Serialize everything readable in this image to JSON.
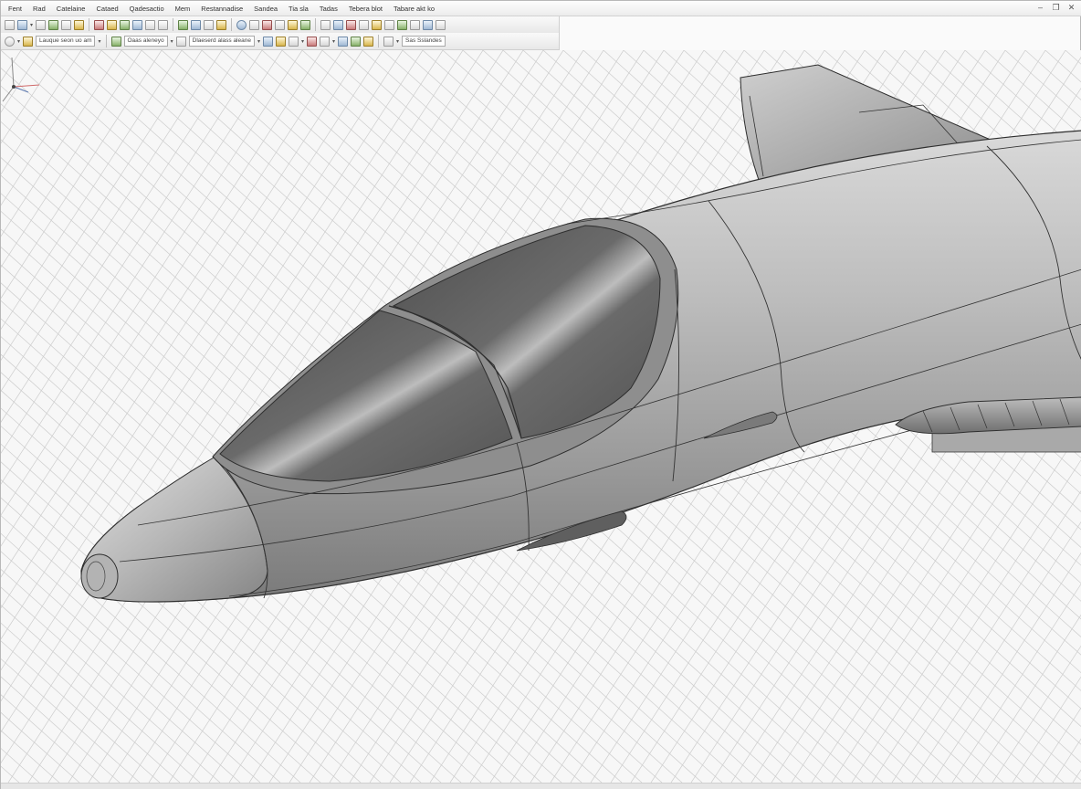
{
  "menu": {
    "items": [
      "Fent",
      "Rad",
      "Catelaine",
      "Cataed",
      "Qadesactio",
      "Mem",
      "Restannadise",
      "Sandea",
      "Tia sla",
      "Tadas",
      "Tebera blot",
      "Tabare akt ko"
    ]
  },
  "toolbar": {
    "layer_combo": "Lauque seon uo am",
    "view_combo": "Oaas aleneyo",
    "filter_combo": "Dlaeserd alass aleane",
    "snap_combo": "Sas Sslandes"
  },
  "viewport": {
    "model": "jet-fuselage-nose",
    "grid": true,
    "colors": {
      "background": "#f7f7f7",
      "grid_line": "#cdcdcd",
      "body_light": "#dcdcdc",
      "body_mid": "#a4a4a4",
      "body_dark": "#6f6f6f",
      "canopy": "#5d5d5d",
      "edge": "#2e2e2e"
    }
  },
  "icons": [
    "open-icon",
    "save-icon",
    "print-icon",
    "undo-icon",
    "redo-icon",
    "zoom-icon",
    "rotate-icon",
    "pan-icon",
    "layer-icon",
    "snap-icon",
    "render-icon",
    "axis-triad-icon"
  ]
}
